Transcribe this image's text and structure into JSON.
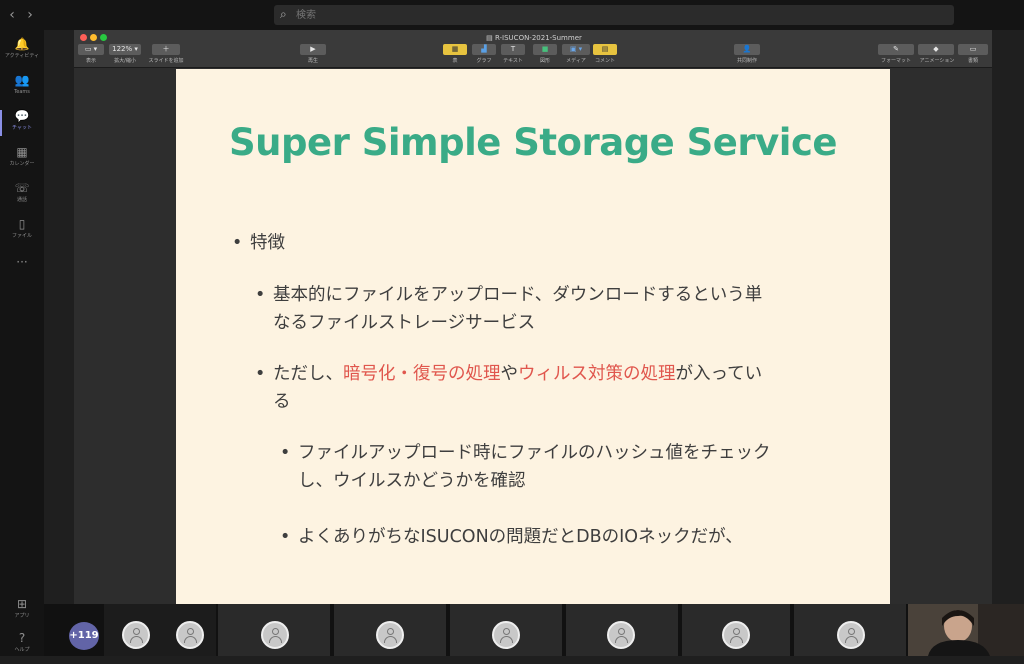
{
  "teams": {
    "nav": {
      "back_icon": "chevron-left-icon",
      "forward_icon": "chevron-right-icon"
    },
    "search": {
      "placeholder": "検索"
    },
    "rail": [
      {
        "label": "アクティビティ",
        "icon": "bell-icon",
        "glyph": "🔔"
      },
      {
        "label": "Teams",
        "icon": "teams-icon",
        "glyph": "👥"
      },
      {
        "label": "チャット",
        "icon": "chat-icon",
        "glyph": "💬"
      },
      {
        "label": "カレンダー",
        "icon": "calendar-icon",
        "glyph": "▦"
      },
      {
        "label": "通話",
        "icon": "phone-icon",
        "glyph": "☏"
      },
      {
        "label": "ファイル",
        "icon": "file-icon",
        "glyph": "▯"
      },
      {
        "label": "",
        "icon": "more-icon",
        "glyph": "···"
      },
      {
        "label": "アプリ",
        "icon": "apps-icon",
        "glyph": "⊞"
      },
      {
        "label": "ヘルプ",
        "icon": "help-icon",
        "glyph": "?"
      }
    ],
    "participants_more": "+119"
  },
  "keynote": {
    "title": "R-ISUCON-2021-Summer",
    "toolbar": {
      "view": "表示",
      "zoom_value": "122%",
      "zoom": "拡大/縮小",
      "add_slide": "スライドを追加",
      "play": "再生",
      "table": "表",
      "chart": "グラフ",
      "text": "テキスト",
      "shape": "図形",
      "media": "メディア",
      "comment": "コメント",
      "collaborate": "共同制作",
      "format": "フォーマット",
      "animate": "アニメーション",
      "document": "書類"
    }
  },
  "slide": {
    "title": "Super Simple Storage Service",
    "b1": "特徴",
    "b2_l1": "基本的にファイルをアップロード、ダウンロードするという単",
    "b2_l2": "なるファイルストレージサービス",
    "b3_pre": "ただし、",
    "b3_hl1": "暗号化・復号の処理",
    "b3_mid": "や",
    "b3_hl2": "ウィルス対策の処理",
    "b3_post": "が入ってい",
    "b3_l2": "る",
    "b4_l1": "ファイルアップロード時にファイルのハッシュ値をチェック",
    "b4_l2": "し、ウイルスかどうかを確認",
    "b5": "よくありがちなISUCONの問題だとDBのIOネックだが、",
    "bullet": "•",
    "highlight_color": "#e0564d",
    "title_color": "#3aab87"
  }
}
